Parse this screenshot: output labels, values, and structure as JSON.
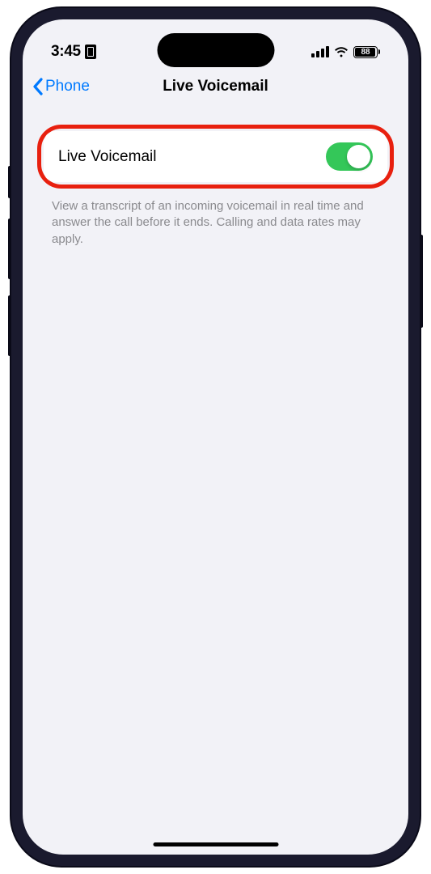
{
  "status_bar": {
    "time": "3:45",
    "battery_percent": "88"
  },
  "nav": {
    "back_label": "Phone",
    "title": "Live Voicemail"
  },
  "setting": {
    "label": "Live Voicemail",
    "toggle_on": true,
    "description": "View a transcript of an incoming voicemail in real time and answer the call before it ends. Calling and data rates may apply."
  }
}
